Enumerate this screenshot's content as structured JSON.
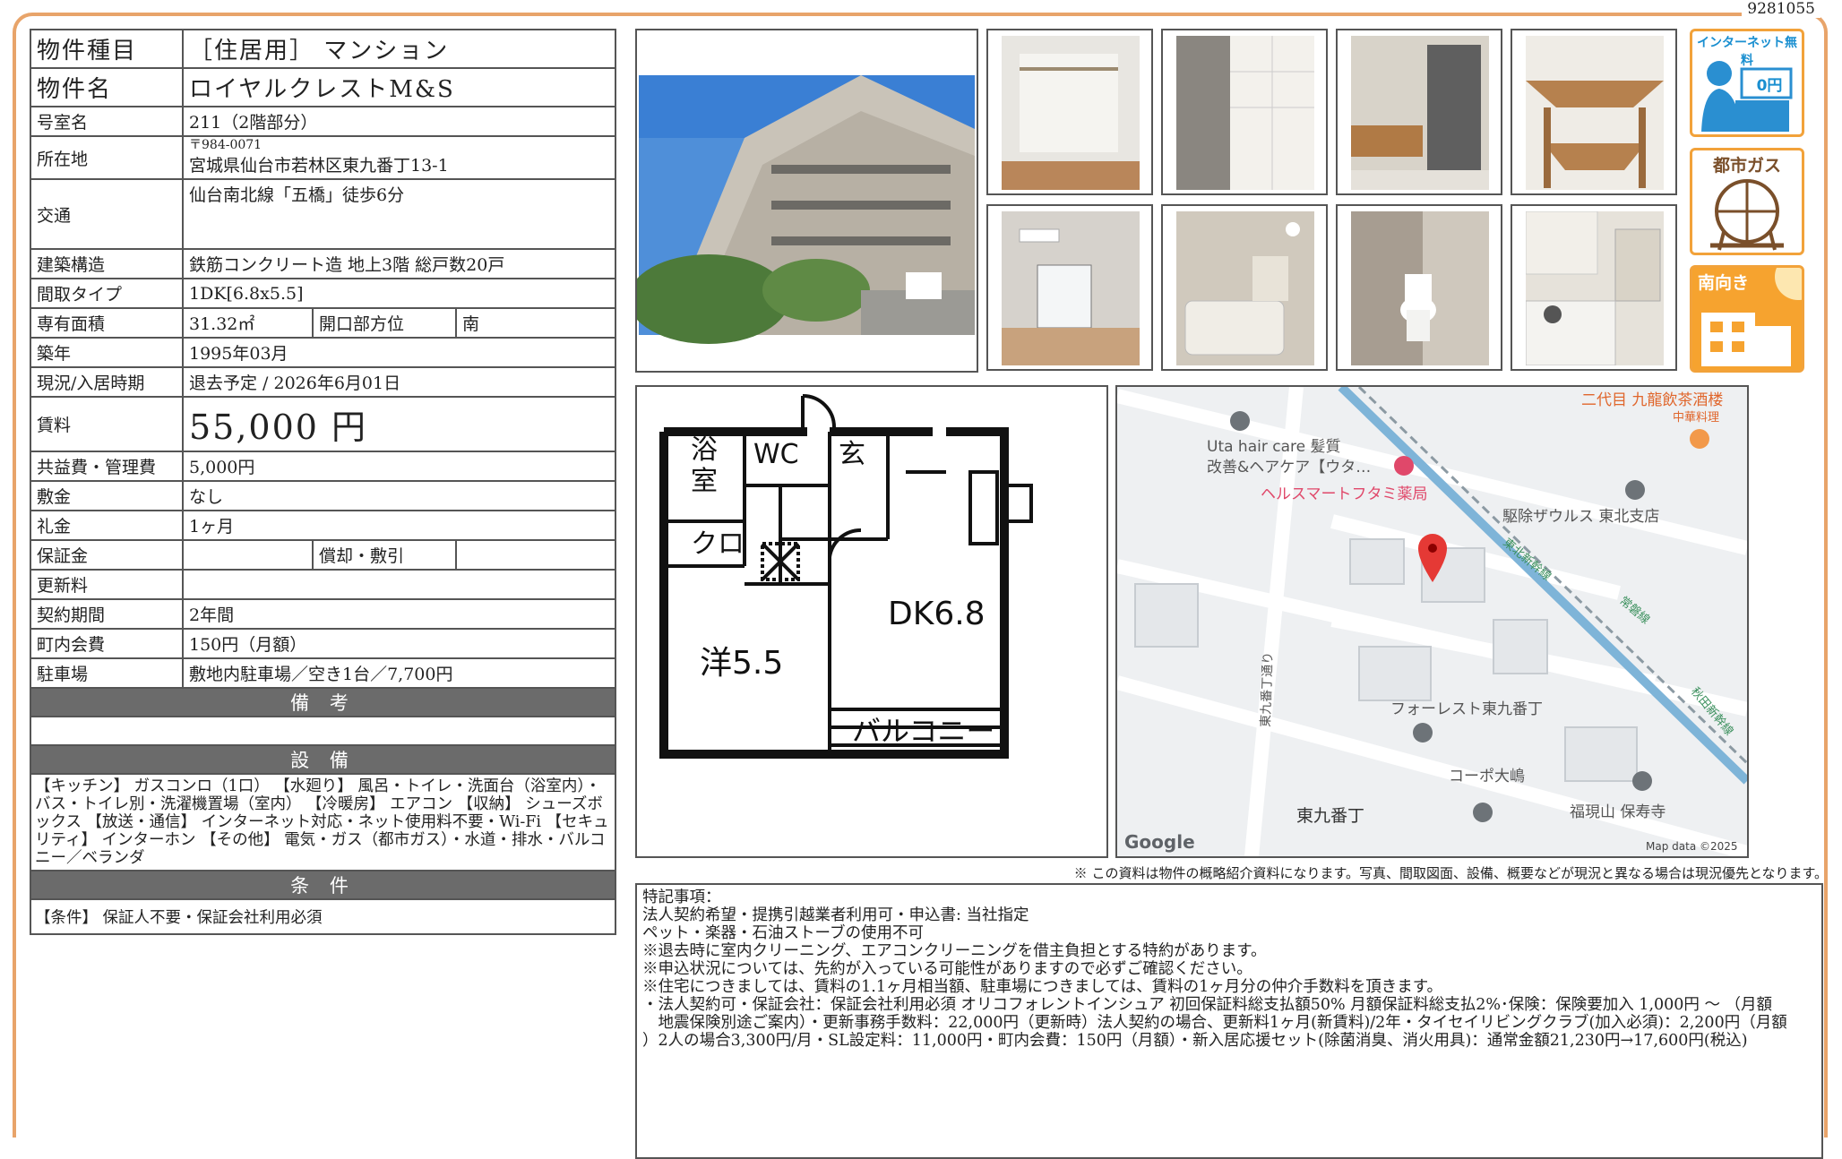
{
  "doc_number": "9281055",
  "spec": {
    "type_label": "物件種目",
    "type_value": "［住居用］ マンション",
    "name_label": "物件名",
    "name_value": "ロイヤルクレストM&S",
    "room_label": "号室名",
    "room_value": "211（2階部分）",
    "addr_label": "所在地",
    "addr_zip": "〒984-0071",
    "addr_value": "宮城県仙台市若林区東九番丁13-1",
    "traffic_label": "交通",
    "traffic_value": "仙台南北線「五橋」徒歩6分",
    "structure_label": "建築構造",
    "structure_value": "鉄筋コンクリート造 地上3階 総戸数20戸",
    "layout_label": "間取タイプ",
    "layout_value": "1DK[6.8x5.5]",
    "area_label": "専有面積",
    "area_value": "31.32㎡",
    "opening_label": "開口部方位",
    "opening_value": "南",
    "built_label": "築年",
    "built_value": "1995年03月",
    "status_label": "現況/入居時期",
    "status_value": "退去予定 / 2026年6月01日",
    "rent_label": "賃料",
    "rent_value": "55,000 円",
    "fee_label": "共益費・管理費",
    "fee_value": "5,000円",
    "deposit_label": "敷金",
    "deposit_value": "なし",
    "key_label": "礼金",
    "key_value": "1ヶ月",
    "guarantee_label": "保証金",
    "guarantee_value": "",
    "amort_label": "償却・敷引",
    "amort_value": "",
    "renew_label": "更新料",
    "renew_value": "",
    "term_label": "契約期間",
    "term_value": "2年間",
    "town_label": "町内会費",
    "town_value": "150円（月額）",
    "parking_label": "駐車場",
    "parking_value": "敷地内駐車場／空き1台／7,700円",
    "remarks_header": "備 考",
    "equip_header": "設 備",
    "equip_value": "【キッチン】 ガスコンロ（1口） 【水廻り】 風呂・トイレ・洗面台（浴室内）・バス・トイレ別・洗濯機置場（室内） 【冷暖房】 エアコン 【収納】 シューズボックス 【放送・通信】 インターネット対応・ネット使用料不要・Wi-Fi 【セキュリティ】 インターホン 【その他】 電気・ガス（都市ガス）・水道・排水・バルコニー／ベランダ",
    "cond_header": "条 件",
    "cond_value": "【条件】 保証人不要・保証会社利用必須"
  },
  "badges": {
    "internet": "インターネット無料",
    "internet_price": "0円",
    "gas": "都市ガス",
    "south": "南向き"
  },
  "floorplan": {
    "bath": "浴室",
    "wc": "WC",
    "entrance": "玄",
    "closet": "クロ",
    "dk": "DK6.8",
    "western": "洋5.5",
    "balcony": "バルコニー"
  },
  "map": {
    "shop1": "二代目 九龍飲茶酒楼",
    "shop1_sub": "中華料理",
    "hair1": "Uta hair care 髪質",
    "hair2": "改善&ヘアケア【ウタ…",
    "pharmacy": "ヘルスマートフタミ薬局",
    "pest": "駆除ザウルス 東北支店",
    "rail1": "東北新幹線",
    "rail2": "常磐線",
    "rail3": "秋田新幹線",
    "street": "東九番丁通り",
    "forest": "フォーレスト東九番丁",
    "corpo": "コーポ大嶋",
    "area": "東九番丁",
    "temple": "福現山 保寿寺",
    "google": "Google",
    "mapdata": "Map data ©2025"
  },
  "note": "※ この資料は物件の概略紹介資料になります。写真、間取図面、設備、概要などが現況と異なる場合は現況優先となります。",
  "special": {
    "lines": [
      "特記事項：",
      "法人契約希望・提携引越業者利用可・申込書: 当社指定",
      "ペット・楽器・石油ストーブの使用不可",
      "※退去時に室内クリーニング、エアコンクリーニングを借主負担とする特約があります。",
      "※申込状況については、先約が入っている可能性がありますので必ずご確認ください。",
      "※住宅につきましては、賃料の1.1ヶ月相当額、駐車場につきましては、賃料の1ヶ月分の仲介手数料を頂きます。",
      "・法人契約可・保証会社：保証会社利用必須 オリコフォレントインシュア 初回保証料総支払額50% 月額保証料総支払2%･保険：保険要加入 1,000円 ～ （月額",
      "　地震保険別途ご案内）・更新事務手数料：22,000円（更新時）法人契約の場合、更新料1ヶ月(新賃料)/2年・タイセイリビングクラブ(加入必須)：2,200円（月額",
      "）2人の場合3,300円/月・SL設定料：11,000円・町内会費：150円（月額）・新入居応援セット(除菌消臭、消火用具)：通常金額21,230円→17,600円(税込)"
    ]
  }
}
